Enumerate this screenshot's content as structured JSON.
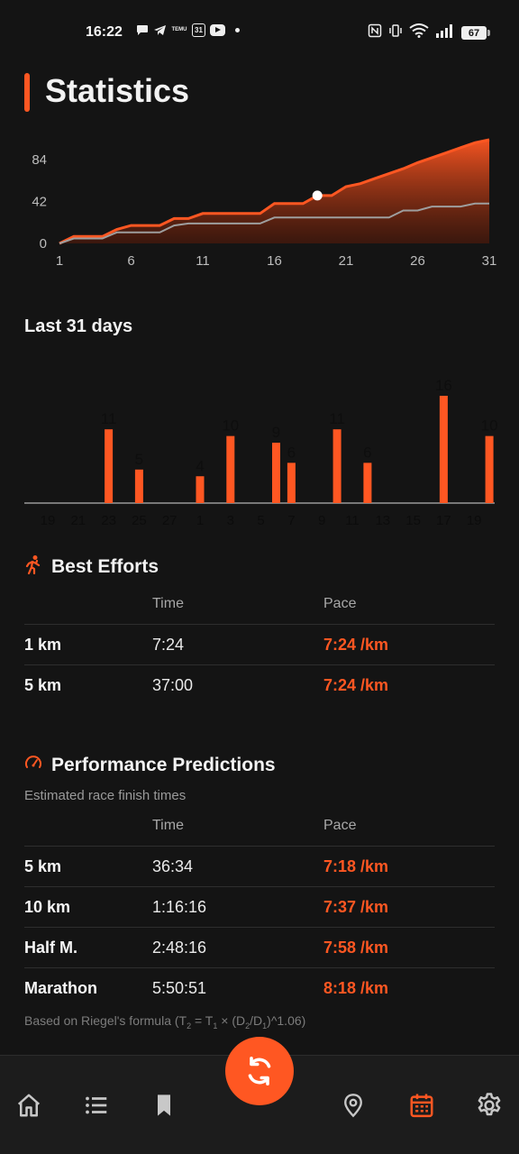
{
  "status_bar": {
    "time": "16:22",
    "calendar_badge": "31",
    "temu_label": "TEMU",
    "battery": "67",
    "icons": [
      "chat-bubble-icon",
      "telegram-icon",
      "temu-icon",
      "calendar-icon",
      "youtube-icon",
      "dot-icon",
      "nfc-icon",
      "vibrate-icon",
      "wifi-icon",
      "signal-icon",
      "battery-icon"
    ]
  },
  "header": {
    "title": "Statistics",
    "accent": "#ff5722"
  },
  "chart_data": [
    {
      "type": "area",
      "x": [
        1,
        2,
        3,
        4,
        5,
        6,
        7,
        8,
        9,
        10,
        11,
        12,
        13,
        14,
        15,
        16,
        17,
        18,
        19,
        20,
        21,
        22,
        23,
        24,
        25,
        26,
        27,
        28,
        29,
        30,
        31
      ],
      "series": [
        {
          "values": [
            0,
            7,
            7,
            7,
            14,
            18,
            18,
            18,
            25,
            25,
            30,
            30,
            30,
            30,
            30,
            40,
            40,
            40,
            48,
            48,
            57,
            60,
            65,
            70,
            75,
            81,
            86,
            91,
            96,
            101,
            104
          ]
        },
        {
          "values": [
            0,
            5,
            5,
            5,
            11,
            11,
            11,
            11,
            18,
            20,
            20,
            20,
            20,
            20,
            20,
            26,
            26,
            26,
            26,
            26,
            26,
            26,
            26,
            26,
            33,
            33,
            37,
            37,
            37,
            40,
            40
          ]
        }
      ],
      "highlight_point": {
        "x": 19,
        "y": 48
      },
      "y_ticks": [
        "84",
        "42",
        "0"
      ],
      "x_ticks": [
        "1",
        "6",
        "11",
        "16",
        "21",
        "26",
        "31"
      ],
      "colors": {
        "fill_top": "#ff5722",
        "line": "#ff5722",
        "secondary_line": "#9e9e9e"
      }
    },
    {
      "type": "bar",
      "title": "Last 31 days",
      "x_ticks": [
        "19",
        "21",
        "23",
        "25",
        "27",
        "1",
        "3",
        "5",
        "7",
        "9",
        "11",
        "13",
        "15",
        "17",
        "19"
      ],
      "bars": [
        {
          "index": 4,
          "value": 11
        },
        {
          "index": 6,
          "value": 5
        },
        {
          "index": 10,
          "value": 4
        },
        {
          "index": 12,
          "value": 10
        },
        {
          "index": 15,
          "value": 9
        },
        {
          "index": 16,
          "value": 6
        },
        {
          "index": 19,
          "value": 11
        },
        {
          "index": 21,
          "value": 6
        },
        {
          "index": 26,
          "value": 16
        },
        {
          "index": 29,
          "value": 10
        }
      ],
      "ylim": [
        0,
        16
      ],
      "color": "#ff5722"
    }
  ],
  "best_efforts": {
    "title": "Best Efforts",
    "col_time": "Time",
    "col_pace": "Pace",
    "rows": [
      {
        "label": "1 km",
        "time": "7:24",
        "pace": "7:24 /km"
      },
      {
        "label": "5 km",
        "time": "37:00",
        "pace": "7:24 /km"
      }
    ]
  },
  "predictions": {
    "title": "Performance Predictions",
    "subtitle": "Estimated race finish times",
    "col_time": "Time",
    "col_pace": "Pace",
    "rows": [
      {
        "label": "5 km",
        "time": "36:34",
        "pace": "7:18 /km"
      },
      {
        "label": "10 km",
        "time": "1:16:16",
        "pace": "7:37 /km"
      },
      {
        "label": "Half M.",
        "time": "2:48:16",
        "pace": "7:58 /km"
      },
      {
        "label": "Marathon",
        "time": "5:50:51",
        "pace": "8:18 /km"
      }
    ],
    "footnote_prefix": "Based on Riegel's formula (T",
    "footnote_mid1": " = T",
    "footnote_mid2": " × (D",
    "footnote_mid3": "/D",
    "footnote_suffix": ")^1.06)",
    "sub_2": "2",
    "sub_1": "1"
  },
  "nav": {
    "items": [
      "home-icon",
      "list-icon",
      "bookmark-icon",
      "location-icon",
      "calendar-icon",
      "settings-icon"
    ],
    "active": "calendar-icon",
    "inactive_color": "#c8c8c8"
  }
}
